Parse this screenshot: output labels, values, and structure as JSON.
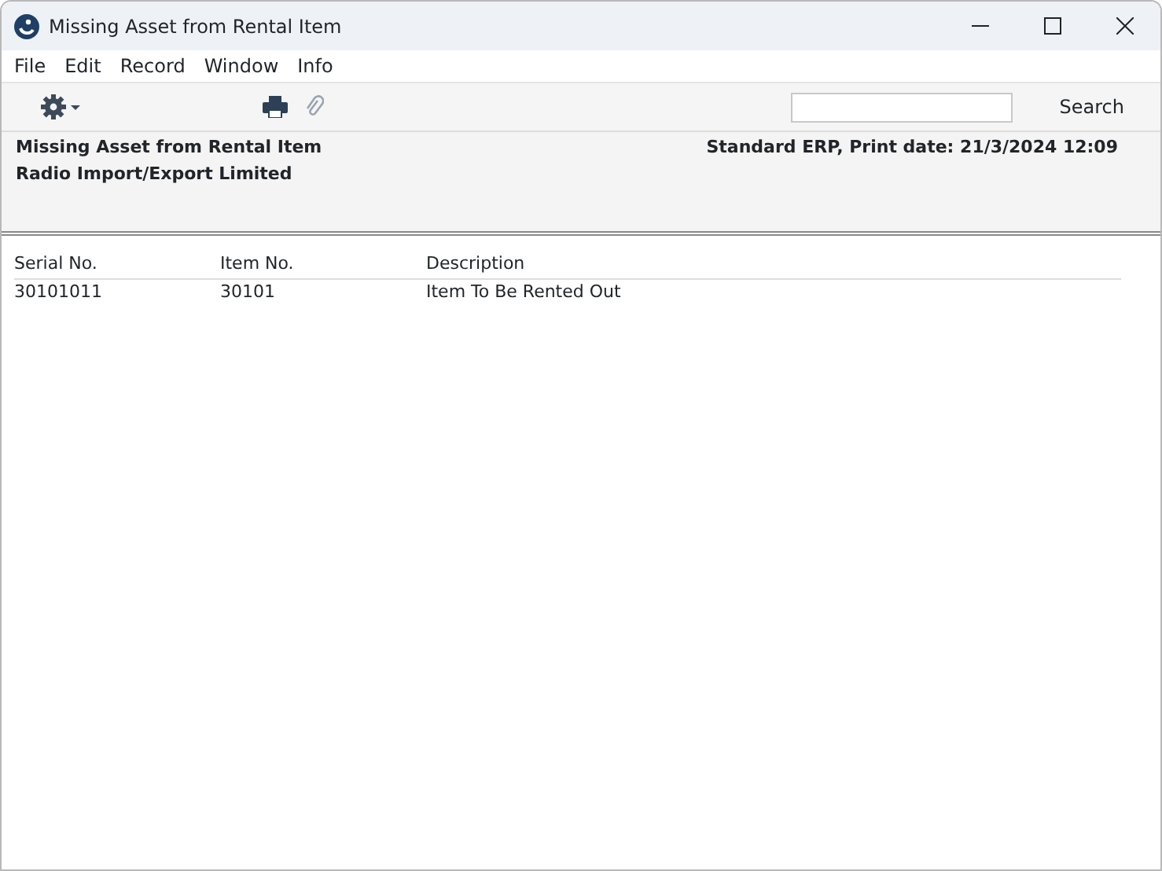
{
  "window": {
    "title": "Missing Asset from Rental Item"
  },
  "menu": [
    "File",
    "Edit",
    "Record",
    "Window",
    "Info"
  ],
  "toolbar": {
    "search_button": "Search"
  },
  "report_header": {
    "title": "Missing Asset from Rental Item",
    "company": "Radio Import/Export Limited",
    "print_info": "Standard ERP, Print date: 21/3/2024 12:09"
  },
  "table": {
    "columns": [
      "Serial No.",
      "Item No.",
      "Description"
    ],
    "rows": [
      [
        "30101011",
        "30101",
        "Item To Be Rented Out"
      ]
    ]
  }
}
